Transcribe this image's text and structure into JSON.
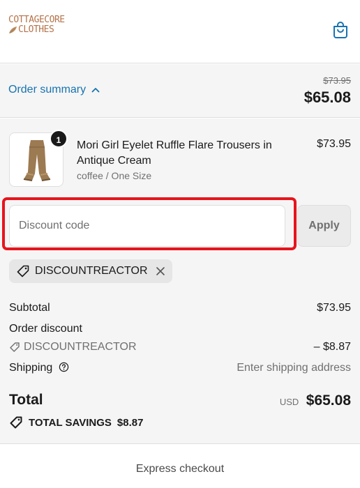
{
  "header": {
    "logo_line1": "COTTAGECORE",
    "logo_line2": "CLOTHES",
    "cart_icon": "shopping-bag-icon"
  },
  "summary": {
    "toggle_label": "Order summary",
    "toggle_icon": "chevron-up-icon",
    "original_total": "$73.95",
    "total": "$65.08"
  },
  "line_items": [
    {
      "quantity": "1",
      "name": "Mori Girl Eyelet Ruffle Flare Trousers in Antique Cream",
      "variant": "coffee / One Size",
      "price": "$73.95"
    }
  ],
  "discount": {
    "placeholder": "Discount code",
    "value": "",
    "apply_label": "Apply",
    "applied_code": "DISCOUNTREACTOR",
    "tag_icon": "tag-icon",
    "remove_icon": "close-icon"
  },
  "totals": {
    "subtotal_label": "Subtotal",
    "subtotal_value": "$73.95",
    "order_discount_label": "Order discount",
    "discount_code": "DISCOUNTREACTOR",
    "discount_value": "– $8.87",
    "shipping_label": "Shipping",
    "shipping_value": "Enter shipping address",
    "total_label": "Total",
    "currency": "USD",
    "total_value": "$65.08",
    "savings_label": "TOTAL SAVINGS",
    "savings_value": "$8.87"
  },
  "express": {
    "label": "Express checkout"
  },
  "colors": {
    "link": "#1773b0",
    "panel_bg": "#f5f5f5",
    "highlight": "#e8141c",
    "logo": "#b5734a"
  }
}
